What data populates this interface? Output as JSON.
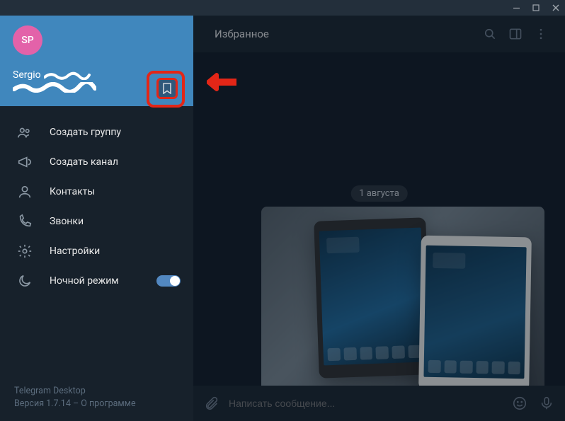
{
  "titlebar": {
    "minimize": "—",
    "maximize": "▢",
    "close": "✕"
  },
  "profile": {
    "initials": "SP",
    "name": "Sergio"
  },
  "menu": {
    "create_group": "Создать группу",
    "create_channel": "Создать канал",
    "contacts": "Контакты",
    "calls": "Звонки",
    "settings": "Настройки",
    "night_mode": "Ночной режим"
  },
  "footer": {
    "app_name": "Telegram Desktop",
    "version_prefix": "Версия 1.7.14 – ",
    "about": "О программе"
  },
  "chat": {
    "title": "Избранное",
    "date": "1 августа",
    "compose_placeholder": "Написать сообщение..."
  }
}
